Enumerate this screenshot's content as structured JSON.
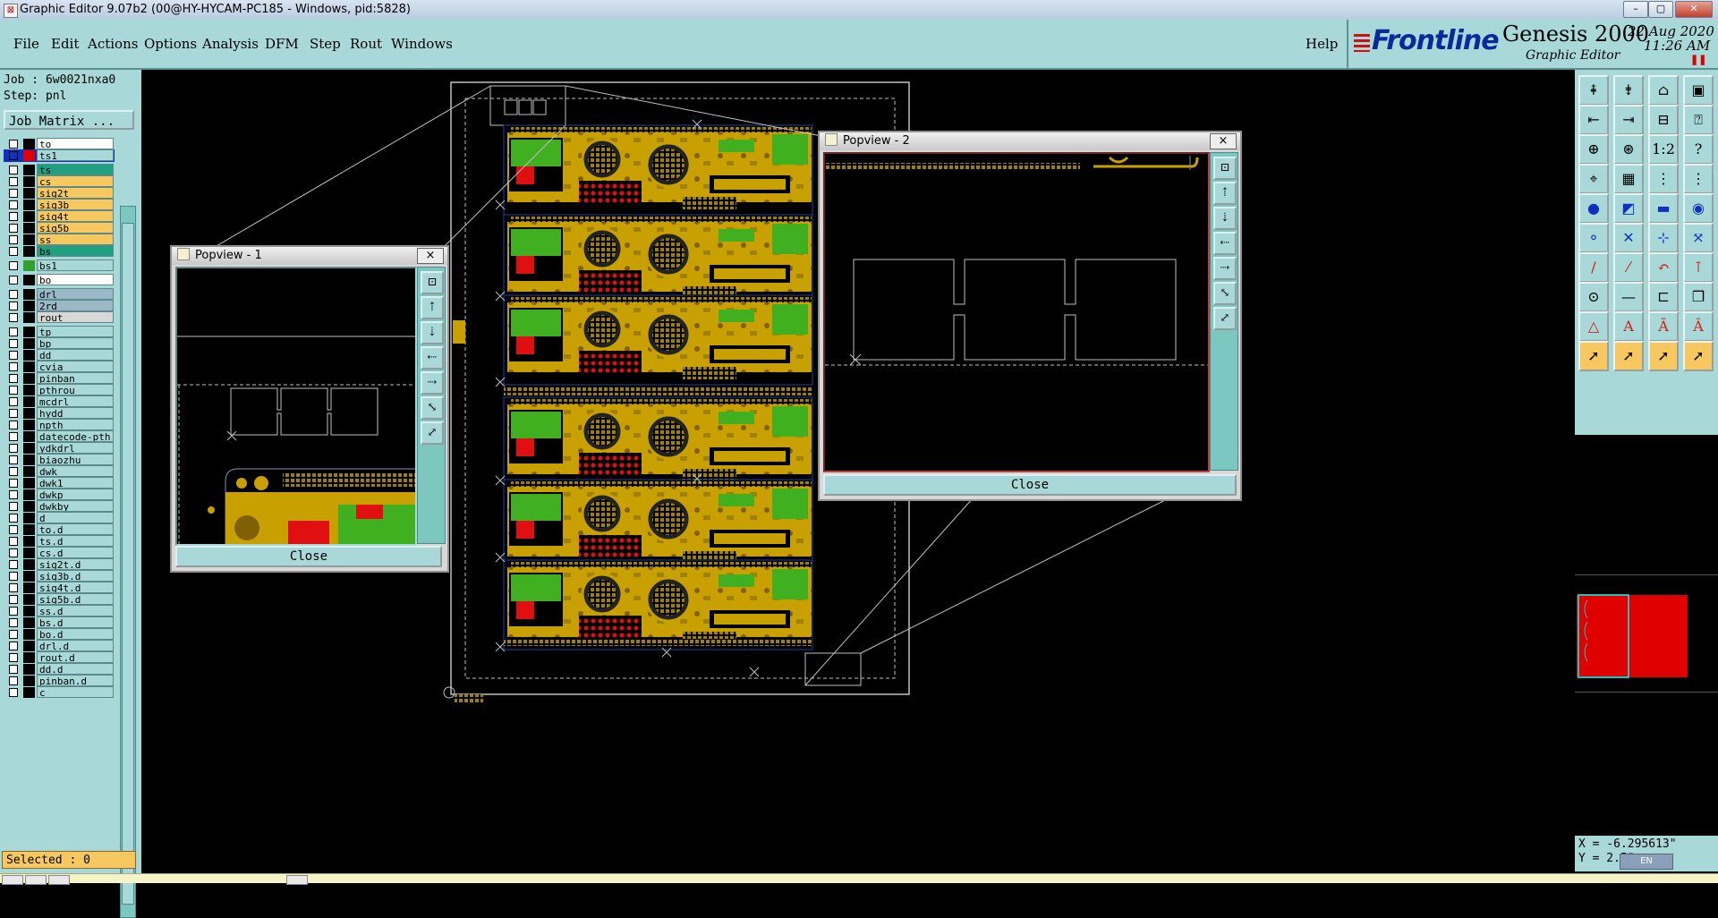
{
  "window": {
    "title": "Graphic Editor 9.07b2 (00@HY-HYCAM-PC185 - Windows, pid:5828)",
    "buttons": [
      "–",
      "▢",
      "✕"
    ]
  },
  "menu": [
    {
      "label": "File"
    },
    {
      "label": "Edit"
    },
    {
      "label": "Actions"
    },
    {
      "label": "Options"
    },
    {
      "label": "Analysis"
    },
    {
      "label": "DFM"
    },
    {
      "label": "Step"
    },
    {
      "label": "Rout"
    },
    {
      "label": "Windows"
    },
    {
      "label": "Help"
    }
  ],
  "brand": {
    "logo": "Frontline",
    "product": "Genesis 2000",
    "subtitle": "Graphic Editor",
    "date": "22 Aug 2020",
    "time": "11:26 AM"
  },
  "job": {
    "job_line": "Job : 6w0021nxa0",
    "step_line": "Step: pnl",
    "matrix_button": "Job Matrix ..."
  },
  "layers": [
    {
      "name": "to",
      "color": "#ffffff",
      "swatch": "#000000"
    },
    {
      "name": "ts1",
      "color": "#f08030",
      "swatch": "#e00000",
      "active": true
    },
    {
      "name": "ts",
      "color": "#20a080",
      "swatch": "#000000"
    },
    {
      "name": "cs",
      "color": "#f8c860",
      "swatch": "#000000"
    },
    {
      "name": "sig2t",
      "color": "#f8c860",
      "swatch": "#000000"
    },
    {
      "name": "sig3b",
      "color": "#f8c860",
      "swatch": "#000000"
    },
    {
      "name": "sig4t",
      "color": "#f8c860",
      "swatch": "#000000"
    },
    {
      "name": "sig5b",
      "color": "#f8c860",
      "swatch": "#000000"
    },
    {
      "name": "ss",
      "color": "#f8c860",
      "swatch": "#000000"
    },
    {
      "name": "bs",
      "color": "#20a080",
      "swatch": "#000000"
    },
    {
      "name": "bs1",
      "color": "#a8d8d8",
      "swatch": "#30a030"
    },
    {
      "name": "bo",
      "color": "#ffffff",
      "swatch": "#000000"
    },
    {
      "name": "drl",
      "color": "#9ab8c8",
      "swatch": "#000000"
    },
    {
      "name": "2rd",
      "color": "#9ab8c8",
      "swatch": "#000000"
    },
    {
      "name": "rout",
      "color": "#d8d8d8",
      "swatch": "#000000"
    },
    {
      "name": "tp",
      "color": "#a8d8d8",
      "swatch": "#000000"
    },
    {
      "name": "bp",
      "color": "#a8d8d8",
      "swatch": "#000000"
    },
    {
      "name": "dd",
      "color": "#a8d8d8",
      "swatch": "#000000"
    },
    {
      "name": "cvia",
      "color": "#a8d8d8",
      "swatch": "#000000"
    },
    {
      "name": "pinban",
      "color": "#a8d8d8",
      "swatch": "#000000"
    },
    {
      "name": "pthrou",
      "color": "#a8d8d8",
      "swatch": "#000000"
    },
    {
      "name": "mcdrl",
      "color": "#a8d8d8",
      "swatch": "#000000"
    },
    {
      "name": "hydd",
      "color": "#a8d8d8",
      "swatch": "#000000"
    },
    {
      "name": "npth",
      "color": "#a8d8d8",
      "swatch": "#000000"
    },
    {
      "name": "datecode-pth",
      "color": "#a8d8d8",
      "swatch": "#000000"
    },
    {
      "name": "ydkdrl",
      "color": "#a8d8d8",
      "swatch": "#000000"
    },
    {
      "name": "biaozhu",
      "color": "#a8d8d8",
      "swatch": "#000000"
    },
    {
      "name": "dwk",
      "color": "#a8d8d8",
      "swatch": "#000000"
    },
    {
      "name": "dwk1",
      "color": "#a8d8d8",
      "swatch": "#000000"
    },
    {
      "name": "dwkp",
      "color": "#a8d8d8",
      "swatch": "#000000"
    },
    {
      "name": "dwkby",
      "color": "#a8d8d8",
      "swatch": "#000000"
    },
    {
      "name": "d",
      "color": "#a8d8d8",
      "swatch": "#000000"
    },
    {
      "name": "to.d",
      "color": "#a8d8d8",
      "swatch": "#000000"
    },
    {
      "name": "ts.d",
      "color": "#a8d8d8",
      "swatch": "#000000"
    },
    {
      "name": "cs.d",
      "color": "#a8d8d8",
      "swatch": "#000000"
    },
    {
      "name": "sig2t.d",
      "color": "#a8d8d8",
      "swatch": "#000000"
    },
    {
      "name": "sig3b.d",
      "color": "#a8d8d8",
      "swatch": "#000000"
    },
    {
      "name": "sig4t.d",
      "color": "#a8d8d8",
      "swatch": "#000000"
    },
    {
      "name": "sig5b.d",
      "color": "#a8d8d8",
      "swatch": "#000000"
    },
    {
      "name": "ss.d",
      "color": "#a8d8d8",
      "swatch": "#000000"
    },
    {
      "name": "bs.d",
      "color": "#a8d8d8",
      "swatch": "#000000"
    },
    {
      "name": "bo.d",
      "color": "#a8d8d8",
      "swatch": "#000000"
    },
    {
      "name": "drl.d",
      "color": "#a8d8d8",
      "swatch": "#000000"
    },
    {
      "name": "rout.d",
      "color": "#a8d8d8",
      "swatch": "#000000"
    },
    {
      "name": "dd.d",
      "color": "#a8d8d8",
      "swatch": "#000000"
    },
    {
      "name": "pinban.d",
      "color": "#a8d8d8",
      "swatch": "#000000"
    },
    {
      "name": "c",
      "color": "#a8d8d8",
      "swatch": "#000000"
    }
  ],
  "status": {
    "selected": "Selected : 0",
    "x": "X = -6.295613\"",
    "y": "Y = 2.5\"",
    "lang": "EN"
  },
  "popview1": {
    "title": "Popview - 1",
    "close_x": "×",
    "close_label": "Close"
  },
  "popview2": {
    "title": "Popview - 2",
    "close_x": "×",
    "close_label": "Close"
  },
  "colors": {
    "panel": "#a8d8d8",
    "copper": "#c8a000",
    "solder_green": "#40b020",
    "drill_red": "#e01010",
    "highlight": "#f8c860"
  },
  "right_toolbar_icons": [
    "fit-top-icon",
    "fit-bottom-icon",
    "home-icon",
    "window-icon",
    "pan-left-icon",
    "pan-right-icon",
    "zoom-area-icon",
    "measure-icon",
    "fit-all-icon",
    "zoom-in-icon",
    "scale-icon",
    "help-icon",
    "snap-icon",
    "grid-icon",
    "layer-colors-icon",
    "layer-settings-icon",
    "pad-icon",
    "surface-icon",
    "line-style-icon",
    "round-icon",
    "connect-icon",
    "delete-node-icon",
    "add-node-icon",
    "move-node-icon",
    "line-icon",
    "arc-line-icon",
    "arc-icon",
    "route-icon",
    "feature-add-icon",
    "dash-icon",
    "bracket-icon",
    "copy-icon",
    "triangle-icon",
    "text-a-icon",
    "text-box-icon",
    "text-style-icon",
    "select-icon",
    "select-box-icon",
    "select-move-icon",
    "select-group-icon"
  ]
}
